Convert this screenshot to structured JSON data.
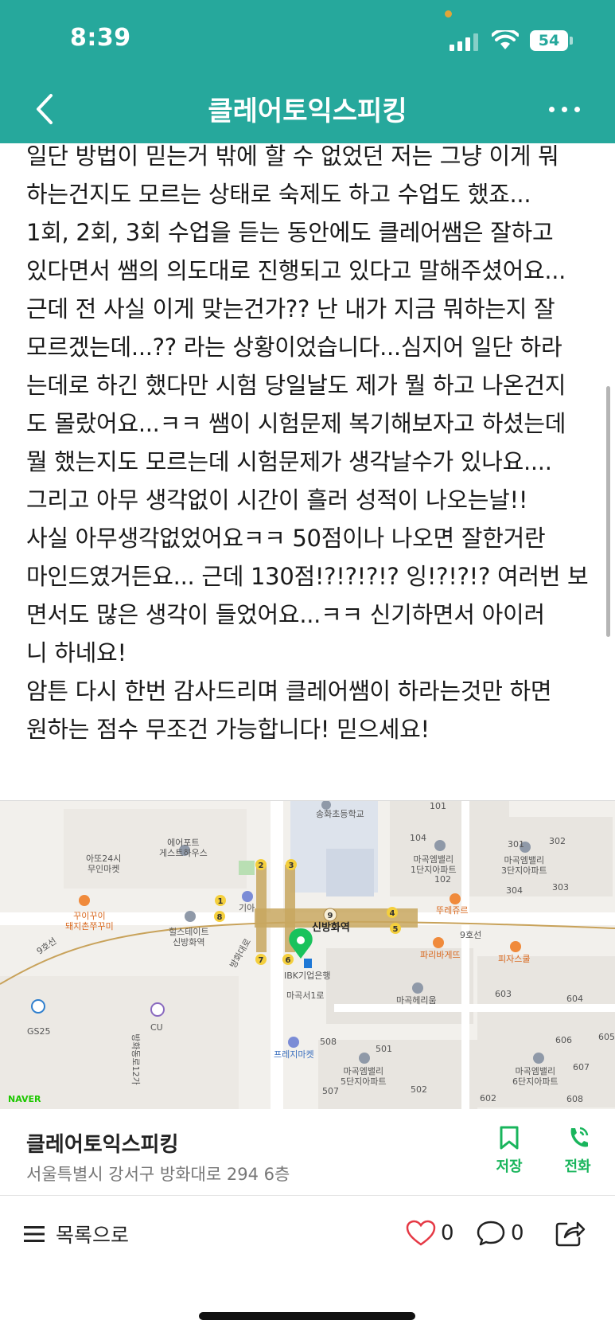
{
  "status_bar": {
    "time": "8:39",
    "battery": "54"
  },
  "nav": {
    "title": "클레어토익스피킹",
    "back_icon": "chevron-left-icon",
    "more_icon": "ellipsis-icon"
  },
  "article": {
    "lines": [
      "일단 방법이 믿는거 밖에 할 수 없었던 저는 그냥 이게 뭐",
      "하는건지도 모르는 상태로 숙제도 하고 수업도 했죠...",
      "1회, 2회, 3회 수업을 듣는 동안에도 클레어쌤은 잘하고",
      "있다면서 쌤의 의도대로 진행되고 있다고 말해주셨어요...",
      "근데 전 사실 이게 맞는건가?? 난 내가 지금 뭐하는지 잘",
      "모르겠는데...?? 라는 상황이었습니다...심지어 일단 하라",
      "는데로 하긴 했다만 시험 당일날도 제가 뭘 하고 나온건지",
      "도 몰랐어요...ㅋㅋ 쌤이 시험문제 복기해보자고 하셨는데",
      "뭘 했는지도 모르는데 시험문제가 생각날수가 있나요....",
      "그리고 아무 생각없이 시간이 흘러 성적이 나오는날!!",
      "사실 아무생각없었어요ㅋㅋ 50점이나 나오면 잘한거란",
      "마인드였거든요... 근데 130점!?!?!?!? 잉!?!?!? 여러번 보",
      "면서도 많은 생각이 들었어요...ㅋㅋ  신기하면서 아이러",
      "니 하네요!",
      "암튼 다시 한번 감사드리며 클레어쌤이 하라는것만 하면",
      "원하는 점수 무조건 가능합니다! 믿으세요!"
    ]
  },
  "map": {
    "labels": {
      "school": "송화초등학교",
      "guesthouse": "에어포트\n게스트하우스",
      "market24": "아또24시\n무인마켓",
      "pork": "꾸이꾸이\n돼지촌쭈꾸미",
      "hillstate": "힐스테이트\n신방화역",
      "apt1": "마곡엠밸리\n1단지아파트",
      "apt3": "마곡엠밸리\n3단지아파트",
      "apt5": "마곡엠밸리\n5단지아파트",
      "apt6": "마곡엠밸리\n6단지아파트",
      "twosome": "뚜레쥬르",
      "paris": "파리바게뜨",
      "pizza": "피자스쿨",
      "ibk": "IBK기업은행",
      "station": "신방화역",
      "herium": "마곡헤리움",
      "fresh": "프레지마켓",
      "gs25": "GS25",
      "cu": "CU",
      "road1": "마곡서1로",
      "road2": "방화대로",
      "road3": "방화동로12가",
      "line9a": "9호선",
      "line9b": "9호선",
      "kia": "기아",
      "b101": "101",
      "b102": "102",
      "b104": "104",
      "b301": "301",
      "b302": "302",
      "b303": "303",
      "b304": "304",
      "b501": "501",
      "b502": "502",
      "b507": "507",
      "b508": "508",
      "b602": "602",
      "b603": "603",
      "b604": "604",
      "b605": "605",
      "b606": "606",
      "b607": "607",
      "b608": "608"
    },
    "exits": [
      "1",
      "2",
      "3",
      "4",
      "5",
      "6",
      "7",
      "8",
      "9"
    ],
    "provider": "NAVER"
  },
  "place": {
    "name": "클레어토익스피킹",
    "address": "서울특별시 강서구 방화대로 294 6층",
    "save_label": "저장",
    "call_label": "전화"
  },
  "bottom": {
    "list_label": "목록으로",
    "like_count": "0",
    "comment_count": "0"
  },
  "colors": {
    "header": "#26a89c",
    "action_green": "#19b55c",
    "like_red": "#e53945"
  }
}
